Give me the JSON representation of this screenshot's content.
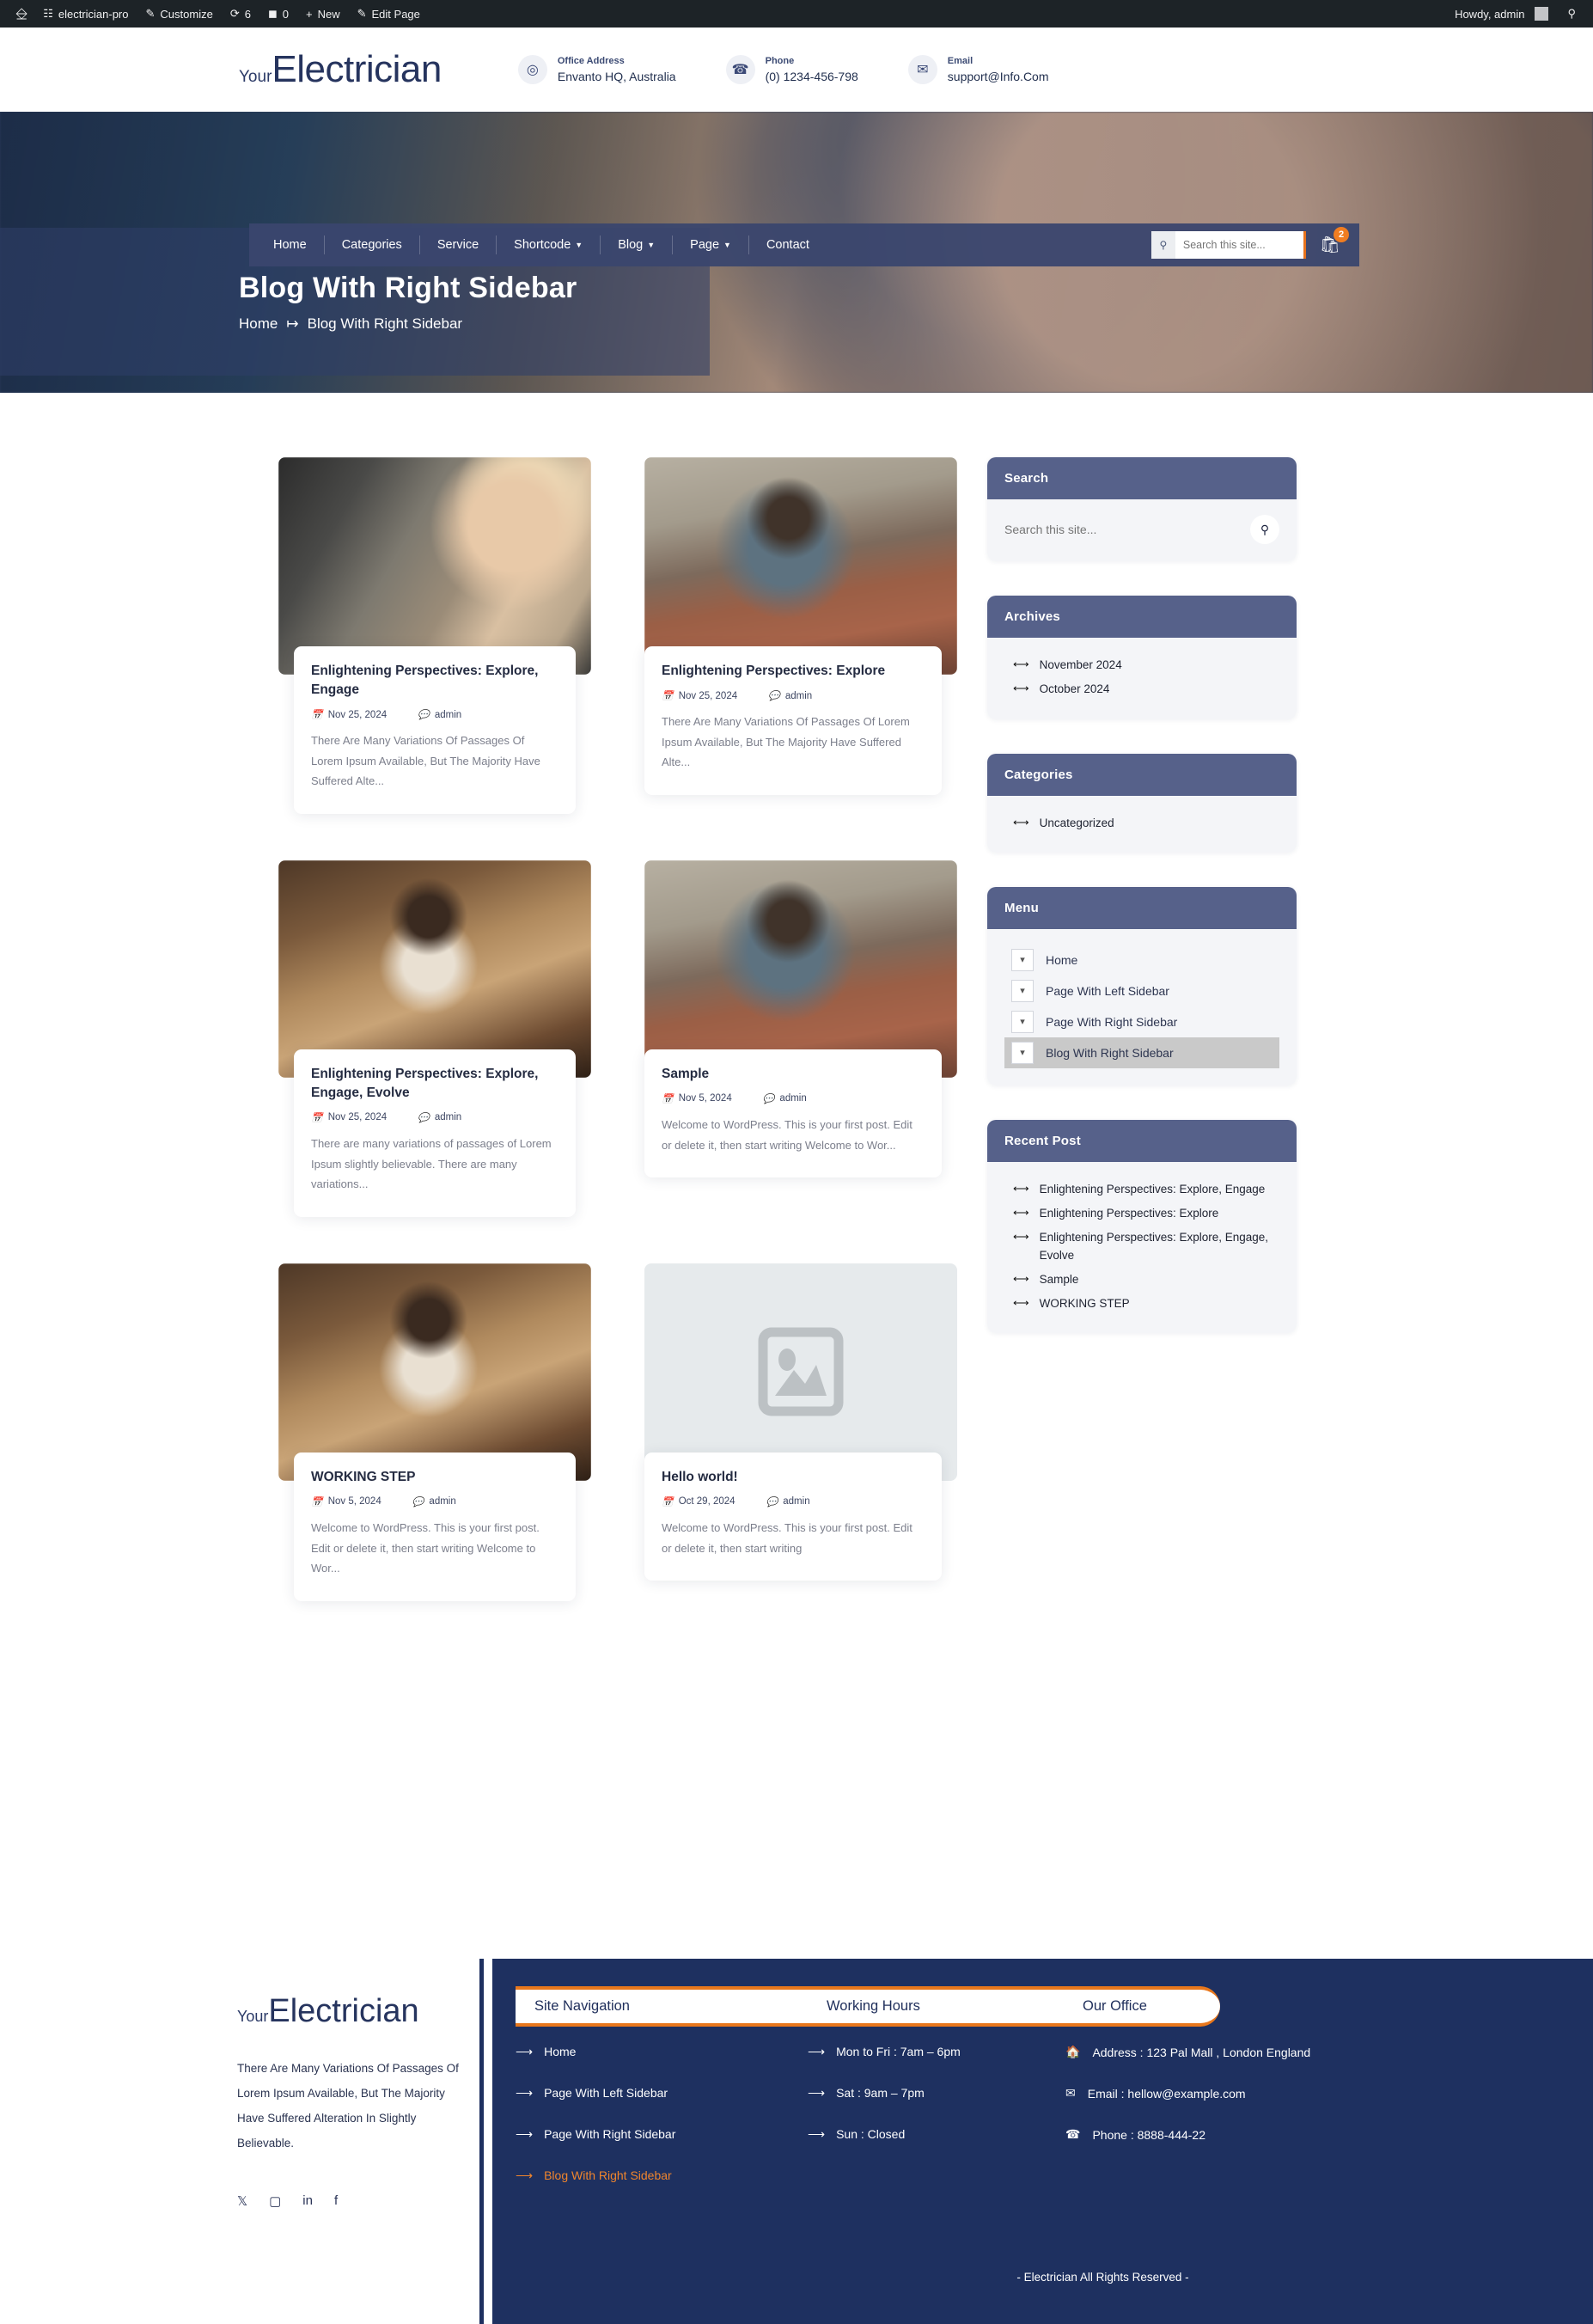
{
  "adminbar": {
    "site": "electrician-pro",
    "customize": "Customize",
    "comments_count": "6",
    "updates_count": "0",
    "new": "New",
    "edit_page": "Edit Page",
    "howdy": "Howdy, admin"
  },
  "header": {
    "logo_small": "Your",
    "logo_big": "Electrician",
    "contacts": [
      {
        "icon": "location-pin-icon",
        "label": "Office Address",
        "value": "Envanto HQ, Australia"
      },
      {
        "icon": "phone-icon",
        "label": "Phone",
        "value": "(0) 1234-456-798"
      },
      {
        "icon": "envelope-icon",
        "label": "Email",
        "value": "support@Info.Com"
      }
    ]
  },
  "nav": {
    "items": [
      {
        "label": "Home",
        "has_caret": false
      },
      {
        "label": "Categories",
        "has_caret": false
      },
      {
        "label": "Service",
        "has_caret": false
      },
      {
        "label": "Shortcode",
        "has_caret": true
      },
      {
        "label": "Blog",
        "has_caret": true
      },
      {
        "label": "Page",
        "has_caret": true
      },
      {
        "label": "Contact",
        "has_caret": false
      }
    ],
    "search_placeholder": "Search this site...",
    "cart_badge": "2"
  },
  "hero": {
    "title": "Blog With Right Sidebar",
    "crumb_home": "Home",
    "crumb_sep": "↦",
    "crumb_current": "Blog With Right Sidebar"
  },
  "posts": [
    {
      "title": "Enlightening Perspectives: Explore, Engage",
      "date": "Nov 25, 2024",
      "author": "admin",
      "excerpt": "There Are Many Variations Of Passages Of Lorem Ipsum Available, But The Majority Have Suffered Alte..."
    },
    {
      "title": "Enlightening Perspectives: Explore",
      "date": "Nov 25, 2024",
      "author": "admin",
      "excerpt": "There Are Many Variations Of Passages Of Lorem Ipsum Available, But The Majority Have Suffered Alte..."
    },
    {
      "title": "Enlightening Perspectives: Explore, Engage, Evolve",
      "date": "Nov 25, 2024",
      "author": "admin",
      "excerpt": "There are many variations of passages of Lorem Ipsum slightly believable. There are many variations..."
    },
    {
      "title": "Sample",
      "date": "Nov 5, 2024",
      "author": "admin",
      "excerpt": "Welcome to WordPress. This is your first post. Edit or delete it, then start writing Welcome to Wor..."
    },
    {
      "title": "WORKING STEP",
      "date": "Nov 5, 2024",
      "author": "admin",
      "excerpt": "Welcome to WordPress. This is your first post. Edit or delete it, then start writing Welcome to Wor..."
    },
    {
      "title": "Hello world!",
      "date": "Oct 29, 2024",
      "author": "admin",
      "excerpt": "Welcome to WordPress. This is your first post. Edit or delete it, then start writing"
    }
  ],
  "sidebar": {
    "search": {
      "title": "Search",
      "placeholder": "Search this site..."
    },
    "archives": {
      "title": "Archives",
      "items": [
        "November 2024",
        "October 2024"
      ]
    },
    "categories": {
      "title": "Categories",
      "items": [
        "Uncategorized"
      ]
    },
    "menu": {
      "title": "Menu",
      "items": [
        {
          "label": "Home",
          "active": false
        },
        {
          "label": "Page With Left Sidebar",
          "active": false
        },
        {
          "label": "Page With Right Sidebar",
          "active": false
        },
        {
          "label": "Blog With Right Sidebar",
          "active": true
        }
      ]
    },
    "recent": {
      "title": "Recent Post",
      "items": [
        "Enlightening Perspectives: Explore, Engage",
        "Enlightening Perspectives: Explore",
        "Enlightening Perspectives: Explore, Engage, Evolve",
        "Sample",
        "WORKING STEP"
      ]
    }
  },
  "footer": {
    "logo_small": "Your",
    "logo_big": "Electrician",
    "description": "There Are Many Variations Of Passages Of Lorem Ipsum Available, But The Majority Have Suffered Alteration In Slightly Believable.",
    "socials": [
      "x-twitter-icon",
      "instagram-icon",
      "linkedin-icon",
      "facebook-icon"
    ],
    "tabs": [
      "Site Navigation",
      "Working Hours",
      "Our Office"
    ],
    "site_nav": [
      {
        "label": "Home",
        "highlight": false
      },
      {
        "label": "Page With Left Sidebar",
        "highlight": false
      },
      {
        "label": "Page With Right Sidebar",
        "highlight": false
      },
      {
        "label": "Blog With Right Sidebar",
        "highlight": true
      }
    ],
    "hours": [
      "Mon to Fri : 7am – 6pm",
      "Sat : 9am – 7pm",
      "Sun : Closed"
    ],
    "office": [
      {
        "icon": "home-icon",
        "text": "Address : 123 Pal Mall , London England"
      },
      {
        "icon": "envelope-icon",
        "text": "Email : hellow@example.com"
      },
      {
        "icon": "phone-icon",
        "text": "Phone : 8888-444-22"
      }
    ],
    "copyright": "- Electrician All Rights Reserved -"
  }
}
